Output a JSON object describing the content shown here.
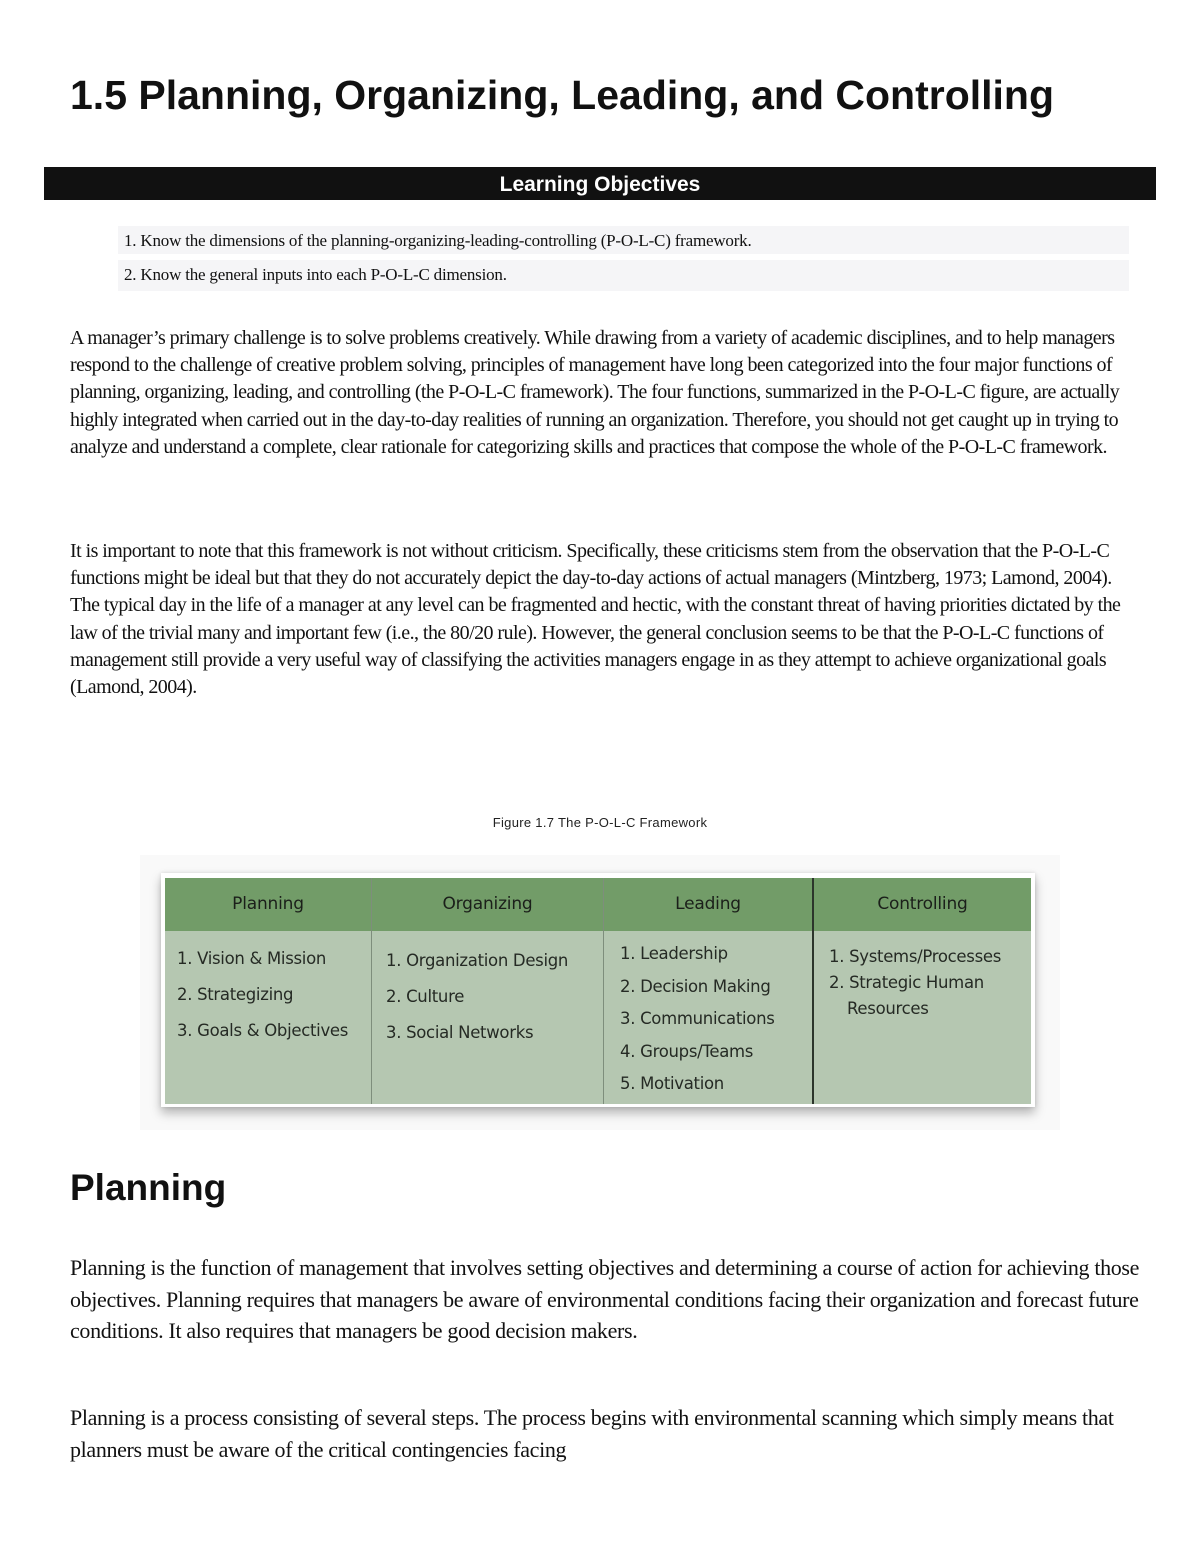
{
  "page_title": "1.5 Planning, Organizing, Leading, and Controlling",
  "learning_objectives": {
    "heading": "Learning Objectives",
    "items": [
      "1. Know the dimensions of the planning-organizing-leading-controlling (P-O-L-C) framework.",
      "2. Know the general inputs into each P-O-L-C dimension."
    ]
  },
  "paragraphs": [
    "A manager’s primary challenge is to solve problems creatively. While drawing from a variety of academic disciplines, and to help managers respond to the challenge of creative problem solving, principles of management have long been categorized into the four major functions of planning, organizing, leading, and controlling (the P-O-L-C framework). The four functions, summarized in the P-O-L-C figure, are actually highly integrated when carried out in the day-to-day realities of running an organization. Therefore, you should not get caught up in trying to analyze and understand a complete, clear rationale for categorizing skills and practices that compose the whole of the P-O-L-C framework.",
    "It is important to note that this framework is not without criticism. Specifically, these criticisms stem from the observation that the P-O-L-C functions might be ideal but that they do not accurately depict the day-to-day actions of actual managers (Mintzberg, 1973; Lamond, 2004). The typical day in the life of a manager at any level can be fragmented and hectic, with the constant threat of having priorities dictated by the law of the trivial many and important few (i.e., the 80/20 rule). However, the general conclusion seems to be that the P-O-L-C functions of management still provide a very useful way of classifying the activities managers engage in as they attempt to achieve organizational goals (Lamond, 2004)."
  ],
  "figure": {
    "caption": "Figure 1.7 The P-O-L-C Framework",
    "header_color": "#729c68",
    "body_color": "#b5c7b1",
    "columns": [
      {
        "title": "Planning",
        "items": [
          "1. Vision & Mission",
          "2. Strategizing",
          "3. Goals & Objectives"
        ]
      },
      {
        "title": "Organizing",
        "items": [
          "1. Organization Design",
          "2. Culture",
          "3. Social Networks"
        ]
      },
      {
        "title": "Leading",
        "items": [
          "1. Leadership",
          "2. Decision Making",
          "3. Communications",
          "4. Groups/Teams",
          "5. Motivation"
        ]
      },
      {
        "title": "Controlling",
        "items": [
          "1. Systems/Processes",
          "2. Strategic Human Resources"
        ]
      }
    ]
  },
  "planning_section": {
    "title": "Planning",
    "paragraphs": [
      "Planning is the function of management that involves setting objectives and determining a course of action for achieving those objectives. Planning requires that managers be aware of environmental conditions facing their organization and forecast future conditions. It also requires that managers be good decision makers.",
      "Planning is a process consisting of several steps. The process begins with environmental scanning which simply means that planners must be aware of the critical contingencies facing"
    ]
  }
}
